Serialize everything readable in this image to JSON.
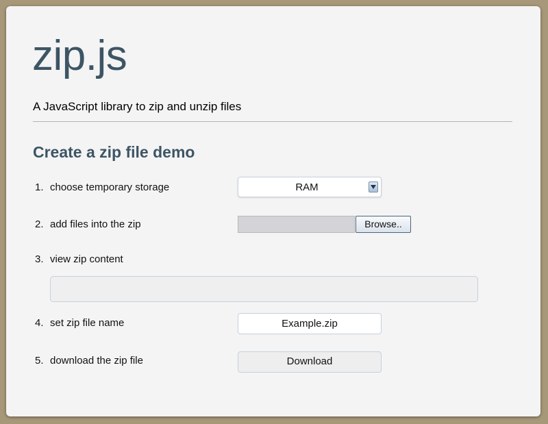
{
  "header": {
    "title": "zip.js",
    "subtitle": "A JavaScript library to zip and unzip files"
  },
  "demo": {
    "heading": "Create a zip file demo",
    "steps": [
      {
        "num": "1.",
        "label": "choose temporary storage"
      },
      {
        "num": "2.",
        "label": "add files into the zip"
      },
      {
        "num": "3.",
        "label": "view zip content"
      },
      {
        "num": "4.",
        "label": "set zip file name"
      },
      {
        "num": "5.",
        "label": "download the zip file"
      }
    ],
    "storage_select": {
      "selected": "RAM",
      "icon": "chevron-down-icon"
    },
    "file_input": {
      "path": "",
      "button_label": "Browse.."
    },
    "zip_content": "",
    "filename_input": {
      "value": "Example.zip"
    },
    "download_button": "Download"
  },
  "colors": {
    "background": "#a8987a",
    "card": "#f4f4f4",
    "accent": "#3d5564"
  }
}
